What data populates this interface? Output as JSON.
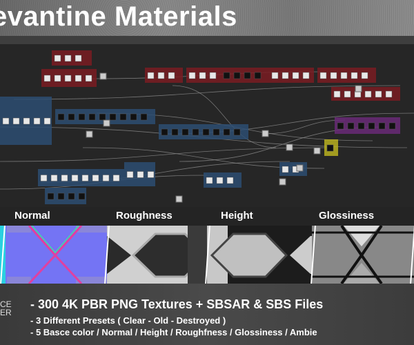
{
  "header": {
    "title": "evantine Materials"
  },
  "maps": [
    {
      "label": "Normal"
    },
    {
      "label": "Roughness"
    },
    {
      "label": "Height"
    },
    {
      "label": "Glossiness"
    }
  ],
  "logo": {
    "line1": "CE",
    "line2": "ER"
  },
  "features": [
    "- 300 4K PBR PNG Textures + SBSAR & SBS Files",
    "-  3 Different Presets ( Clear - Old - Destroyed )",
    "-  5 Basce color / Normal / Height / Roughfness / Glossiness / Ambie"
  ],
  "colors": {
    "red_frame": "#7a1c22",
    "blue_frame": "#2d4d72",
    "purple_frame": "#6a2a78",
    "yellow_frame": "#b8b020",
    "normal_map": "#7a78f0"
  }
}
